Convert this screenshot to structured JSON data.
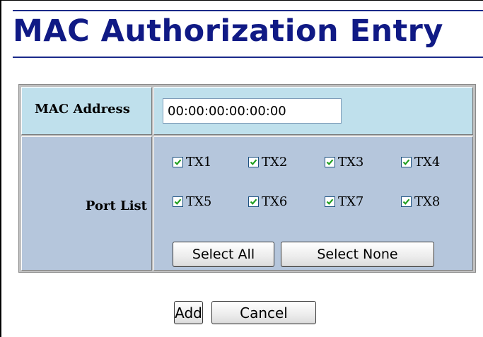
{
  "page": {
    "title": "MAC Authorization Entry"
  },
  "mac_row": {
    "label": "MAC Address",
    "value": "00:00:00:00:00:00"
  },
  "port_row": {
    "label": "Port List",
    "ports": [
      {
        "label": "TX1",
        "checked": true
      },
      {
        "label": "TX2",
        "checked": true
      },
      {
        "label": "TX3",
        "checked": true
      },
      {
        "label": "TX4",
        "checked": true
      },
      {
        "label": "TX5",
        "checked": true
      },
      {
        "label": "TX6",
        "checked": true
      },
      {
        "label": "TX7",
        "checked": true
      },
      {
        "label": "TX8",
        "checked": true
      }
    ],
    "select_all_label": "Select All",
    "select_none_label": "Select None"
  },
  "actions": {
    "add_label": "Add",
    "cancel_label": "Cancel"
  },
  "colors": {
    "title": "#101a85",
    "row1_bg": "#bfe0ec",
    "row2_bg": "#b5c6dc",
    "check": "#1f9e1f"
  }
}
